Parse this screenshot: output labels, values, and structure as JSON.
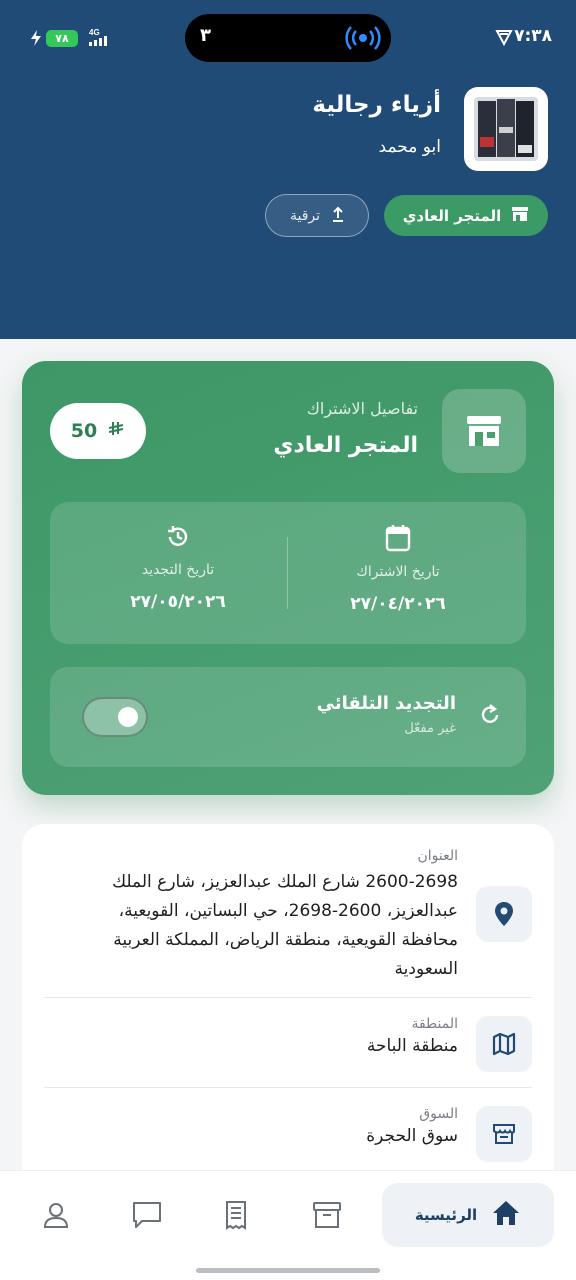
{
  "status_bar": {
    "time": "٧:٣٨",
    "network": "4G",
    "battery": "٧٨",
    "island_count": "٣"
  },
  "header": {
    "store_name": "أزياء رجالية",
    "owner_name": "ابو محمد",
    "plan_button": "المتجر العادي",
    "upgrade_button": "ترقية"
  },
  "subscription": {
    "caption": "تفاصيل الاشتراك",
    "plan_name": "المتجر العادي",
    "price": "50",
    "subscription_date_label": "تاريخ الاشتراك",
    "subscription_date": "٢٧/٠٤/٢٠٢٦",
    "renewal_date_label": "تاريخ التجديد",
    "renewal_date": "٢٧/٠٥/٢٠٢٦",
    "auto_renew_title": "التجديد التلقائي",
    "auto_renew_status": "غير مفعّل"
  },
  "info": {
    "address_label": "العنوان",
    "address_lines": [
      "2600-2698 شارع الملك عبدالعزيز، شارع الملك",
      "عبدالعزيز، 2600-2698، حي البساتين، القويعية،",
      "محافظة القويعية، منطقة الرياض، المملكة العربية",
      "السعودية"
    ],
    "region_label": "المنطقة",
    "region_value": "منطقة الباحة",
    "market_label": "السوق",
    "market_value": "سوق الحجرة"
  },
  "nav": {
    "home_label": "الرئيسية"
  },
  "colors": {
    "header_bg": "#204b77",
    "card_green": "#3d9766",
    "nav_active": "#1e3f66"
  }
}
